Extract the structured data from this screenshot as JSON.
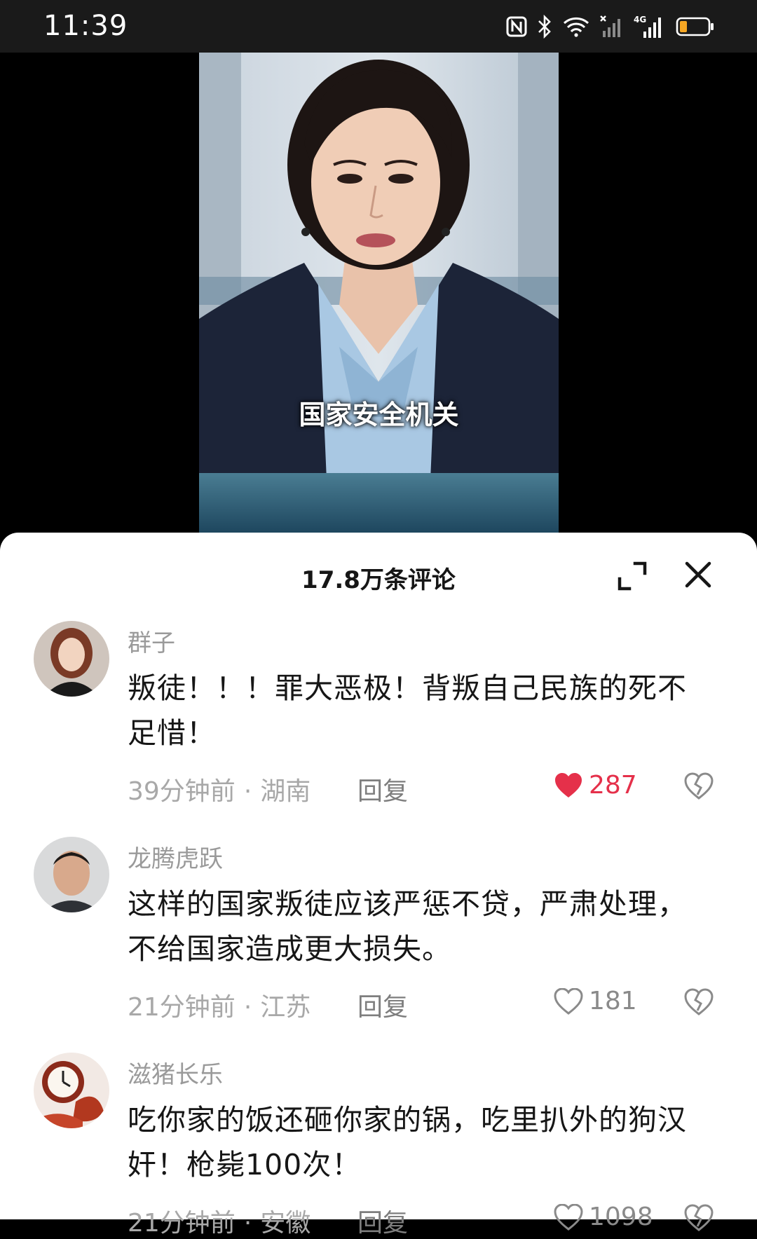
{
  "status_bar": {
    "time": "11:39",
    "icons": [
      "nfc-icon",
      "bluetooth-icon",
      "wifi-icon",
      "signal-x-icon",
      "signal-4g-icon",
      "battery-low-icon"
    ],
    "network_label": "4G",
    "battery_color": "#f5a623"
  },
  "video": {
    "caption": "国家安全机关"
  },
  "comments_panel": {
    "title": "17.8万条评论",
    "like_color": "#e5304a",
    "comments": [
      {
        "name": "群子",
        "text": "叛徒！！！罪大恶极！背叛自己民族的死不足惜！",
        "time": "39分钟前",
        "separator": "·",
        "location": "湖南",
        "reply_label": "回复",
        "likes": "287",
        "liked": true
      },
      {
        "name": "龙腾虎跃",
        "text": "这样的国家叛徒应该严惩不贷，严肃处理，不给国家造成更大损失。",
        "time": "21分钟前",
        "separator": "·",
        "location": "江苏",
        "reply_label": "回复",
        "likes": "181",
        "liked": false
      },
      {
        "name": "滋猪长乐",
        "text": "吃你家的饭还砸你家的锅，吃里扒外的狗汉奸！枪毙100次！",
        "time": "21分钟前",
        "separator": "·",
        "location": "安徽",
        "reply_label": "回复",
        "likes": "1098",
        "liked": false
      }
    ]
  }
}
